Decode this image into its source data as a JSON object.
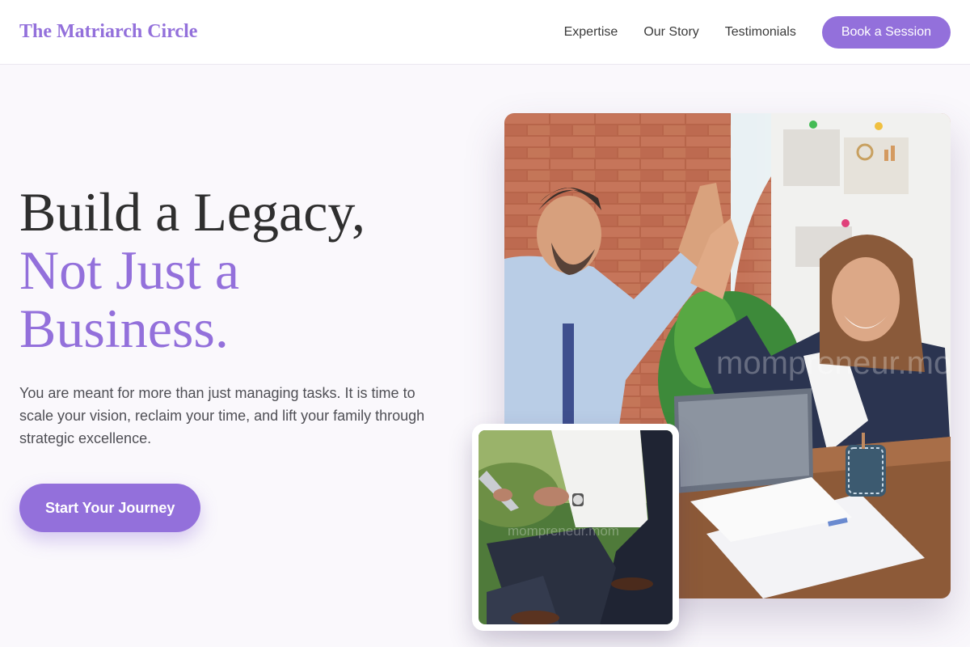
{
  "header": {
    "brand": "The Matriarch Circle",
    "nav": [
      {
        "label": "Expertise"
      },
      {
        "label": "Our Story"
      },
      {
        "label": "Testimonials"
      }
    ],
    "cta_label": "Book a Session"
  },
  "hero": {
    "headline_line1": "Build a Legacy,",
    "headline_line2": "Not Just a",
    "headline_line3": "Business.",
    "subtitle": "You are meant for more than just managing tasks. It is time to scale your vision, reclaim your time, and lift your family through strategic excellence.",
    "button_label": "Start Your Journey"
  },
  "images": {
    "main_watermark": "mompreneur.mom",
    "inset_watermark": "mompreneur.mom"
  },
  "colors": {
    "accent": "#9370db",
    "background": "#faf8fc",
    "text": "#333333"
  }
}
